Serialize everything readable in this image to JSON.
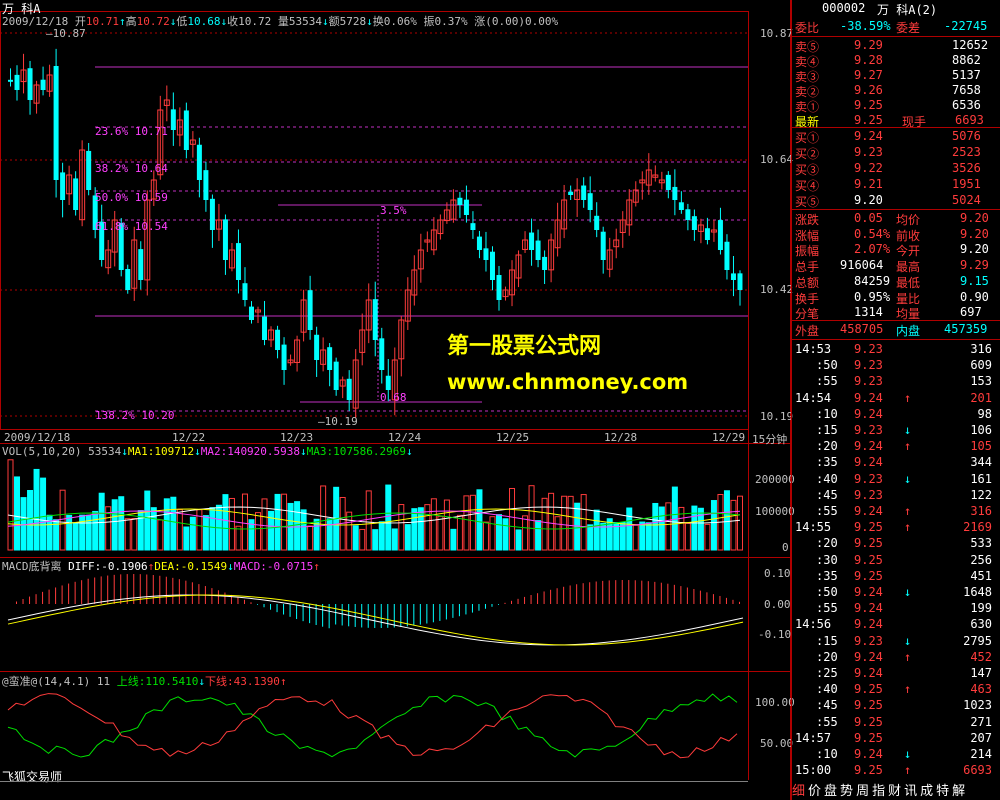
{
  "header": {
    "title": "万  科A",
    "date": "2009/12/18",
    "open_label": "开",
    "open": "10.71",
    "high_label": "高",
    "high": "10.72",
    "low_label": "低",
    "low": "10.68",
    "close_label": "收",
    "close": "10.72",
    "volume_label": "量",
    "volume": "53534",
    "amount_label": "额",
    "amount": "5728",
    "turnover_label": "换",
    "turnover": "0.06%",
    "amplitude_label": "振",
    "amplitude": "0.37%",
    "change_label": "涨",
    "change": "(0.00)0.00%"
  },
  "main_chart": {
    "price_axis": [
      "10.87",
      "10.64",
      "10.42",
      "10.19"
    ],
    "high_marker": "10.87",
    "low_marker": "10.19",
    "fib_levels": [
      {
        "label": "23.6% 10.71"
      },
      {
        "label": "38.2% 10.64"
      },
      {
        "label": "50.0% 10.59"
      },
      {
        "label": "61.8% 10.54"
      },
      {
        "label": "138.2% 10.20"
      }
    ],
    "measure_top": "3.5%",
    "measure_bottom": "0.68",
    "dates": [
      "2009/12/18",
      "12/22",
      "12/23",
      "12/24",
      "12/25",
      "12/28",
      "12/29"
    ],
    "period": "15分钟"
  },
  "volume_panel": {
    "label": "VOL(5,10,20) 53534",
    "ma1": "MA1:109712",
    "ma2": "MA2:140920.5938",
    "ma3": "MA3:107586.2969",
    "axis": [
      "200000",
      "100000",
      "0"
    ]
  },
  "macd_panel": {
    "label": "MACD底背离",
    "diff": "DIFF:-0.1906",
    "dea": "DEA:-0.1549",
    "macd": "MACD:-0.0715",
    "axis": [
      "0.10",
      "0.00",
      "-0.10"
    ]
  },
  "bottom_panel": {
    "label": "@蛮准@(14,4.1) 11",
    "upper": "上线:110.5410",
    "lower": "下线:43.1390",
    "axis": [
      "100.00",
      "50.00"
    ],
    "footer": "飞狐交易师"
  },
  "quote": {
    "code": "000002",
    "name": "万  科A(2)",
    "weibi_label": "委比",
    "weibi": "-38.59%",
    "weicha_label": "委差",
    "weicha": "-22745",
    "asks": [
      {
        "label": "卖⑤",
        "price": "9.29",
        "vol": "12652"
      },
      {
        "label": "卖④",
        "price": "9.28",
        "vol": "8862"
      },
      {
        "label": "卖③",
        "price": "9.27",
        "vol": "5137"
      },
      {
        "label": "卖②",
        "price": "9.26",
        "vol": "7658"
      },
      {
        "label": "卖①",
        "price": "9.25",
        "vol": "6536"
      }
    ],
    "latest_label": "最新",
    "latest": "9.25",
    "xianshou_label": "现手",
    "xianshou": "6693",
    "bids": [
      {
        "label": "买①",
        "price": "9.24",
        "vol": "5076"
      },
      {
        "label": "买②",
        "price": "9.23",
        "vol": "2523"
      },
      {
        "label": "买③",
        "price": "9.22",
        "vol": "3526"
      },
      {
        "label": "买④",
        "price": "9.21",
        "vol": "1951"
      },
      {
        "label": "买⑤",
        "price": "9.20",
        "vol": "5024"
      }
    ],
    "stats": [
      {
        "l1": "涨跌",
        "v1": "0.05",
        "l2": "均价",
        "v2": "9.20"
      },
      {
        "l1": "涨幅",
        "v1": "0.54%",
        "l2": "前收",
        "v2": "9.20"
      },
      {
        "l1": "振幅",
        "v1": "2.07%",
        "l2": "今开",
        "v2": "9.20"
      },
      {
        "l1": "总手",
        "v1": "916064",
        "l2": "最高",
        "v2": "9.29"
      },
      {
        "l1": "总额",
        "v1": "84259",
        "l2": "最低",
        "v2": "9.15"
      },
      {
        "l1": "换手",
        "v1": "0.95%",
        "l2": "量比",
        "v2": "0.90"
      },
      {
        "l1": "分笔",
        "v1": "1314",
        "l2": "均量",
        "v2": "697"
      }
    ],
    "waipan_label": "外盘",
    "waipan": "458705",
    "neipan_label": "内盘",
    "neipan": "457359"
  },
  "trades": [
    {
      "t": "14:53",
      "p": "9.23",
      "v": "316",
      "a": ""
    },
    {
      "t": ":50",
      "p": "9.23",
      "v": "609",
      "a": ""
    },
    {
      "t": ":55",
      "p": "9.23",
      "v": "153",
      "a": ""
    },
    {
      "t": "14:54",
      "p": "9.24",
      "v": "201",
      "a": "up"
    },
    {
      "t": ":10",
      "p": "9.24",
      "v": "98",
      "a": ""
    },
    {
      "t": ":15",
      "p": "9.23",
      "v": "106",
      "a": "down"
    },
    {
      "t": ":20",
      "p": "9.24",
      "v": "105",
      "a": "up"
    },
    {
      "t": ":35",
      "p": "9.24",
      "v": "344",
      "a": ""
    },
    {
      "t": ":40",
      "p": "9.23",
      "v": "161",
      "a": "down"
    },
    {
      "t": ":45",
      "p": "9.23",
      "v": "122",
      "a": ""
    },
    {
      "t": ":55",
      "p": "9.24",
      "v": "316",
      "a": "up"
    },
    {
      "t": "14:55",
      "p": "9.25",
      "v": "2169",
      "a": "up"
    },
    {
      "t": ":20",
      "p": "9.25",
      "v": "533",
      "a": ""
    },
    {
      "t": ":30",
      "p": "9.25",
      "v": "256",
      "a": ""
    },
    {
      "t": ":35",
      "p": "9.25",
      "v": "451",
      "a": ""
    },
    {
      "t": ":50",
      "p": "9.24",
      "v": "1648",
      "a": "down"
    },
    {
      "t": ":55",
      "p": "9.24",
      "v": "199",
      "a": ""
    },
    {
      "t": "14:56",
      "p": "9.24",
      "v": "630",
      "a": ""
    },
    {
      "t": ":15",
      "p": "9.23",
      "v": "2795",
      "a": "down"
    },
    {
      "t": ":20",
      "p": "9.24",
      "v": "452",
      "a": "up"
    },
    {
      "t": ":25",
      "p": "9.24",
      "v": "147",
      "a": ""
    },
    {
      "t": ":40",
      "p": "9.25",
      "v": "463",
      "a": "up"
    },
    {
      "t": ":45",
      "p": "9.25",
      "v": "1023",
      "a": ""
    },
    {
      "t": ":55",
      "p": "9.25",
      "v": "271",
      "a": ""
    },
    {
      "t": "14:57",
      "p": "9.25",
      "v": "207",
      "a": ""
    },
    {
      "t": ":10",
      "p": "9.24",
      "v": "214",
      "a": "down"
    },
    {
      "t": "15:00",
      "p": "9.25",
      "v": "6693",
      "a": "up"
    }
  ],
  "tabs": [
    "细",
    "价",
    "盘",
    "势",
    "周",
    "指",
    "财",
    "讯",
    "成",
    "特",
    "解"
  ],
  "watermark": {
    "line1": "第一股票公式网",
    "line2": "www.chnmoney.com"
  },
  "colors": {
    "up": "#ff3c3c",
    "down": "#00ffff",
    "grid": "#b00000",
    "fib": "#c030c0"
  }
}
